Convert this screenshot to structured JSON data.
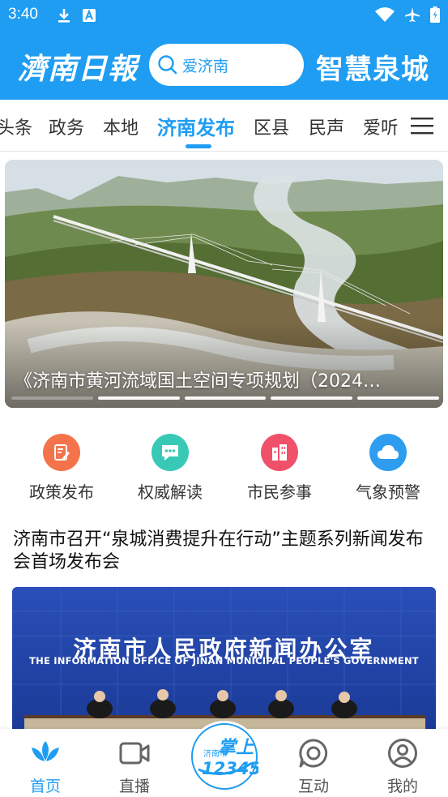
{
  "status_bar": {
    "time": "3:40"
  },
  "header": {
    "logo_text": "濟南日報",
    "search_value": "爱济南",
    "brand_text": "智慧泉城"
  },
  "tabs": [
    {
      "label": "头条",
      "active": false
    },
    {
      "label": "政务",
      "active": false
    },
    {
      "label": "本地",
      "active": false
    },
    {
      "label": "济南发布",
      "active": true
    },
    {
      "label": "区县",
      "active": false
    },
    {
      "label": "民声",
      "active": false
    },
    {
      "label": "爱听",
      "active": false
    }
  ],
  "banner": {
    "caption": "《济南市黄河流域国土空间专项规划（2024…",
    "slide_count": 5,
    "current_slide": 2
  },
  "quick_actions": [
    {
      "label": "政策发布",
      "icon": "document-edit-icon",
      "color": "#f5734a"
    },
    {
      "label": "权威解读",
      "icon": "chat-bubble-icon",
      "color": "#38c9b6"
    },
    {
      "label": "市民参事",
      "icon": "building-icon",
      "color": "#f0516a"
    },
    {
      "label": "气象预警",
      "icon": "cloud-icon",
      "color": "#2e9df0"
    }
  ],
  "article": {
    "title": "济南市召开“泉城消费提升在行动”主题系列新闻发布会首场发布会",
    "image_title": "济南市人民政府新闻办公室",
    "image_subtitle": "THE INFORMATION OFFICE OF JINAN MUNICIPAL PEOPLE'S GOVERNMENT"
  },
  "bottom_nav": [
    {
      "label": "首页",
      "icon": "home-lotus-icon",
      "active": true
    },
    {
      "label": "直播",
      "icon": "video-camera-icon",
      "active": false
    },
    {
      "label": "互动",
      "icon": "chat-ring-icon",
      "active": false
    },
    {
      "label": "我的",
      "icon": "user-icon",
      "active": false
    }
  ],
  "center_badge": {
    "line1": "济南市",
    "line2": "掌上",
    "line3": "12345"
  },
  "colors": {
    "accent": "#1f9df2",
    "text": "#333333"
  }
}
